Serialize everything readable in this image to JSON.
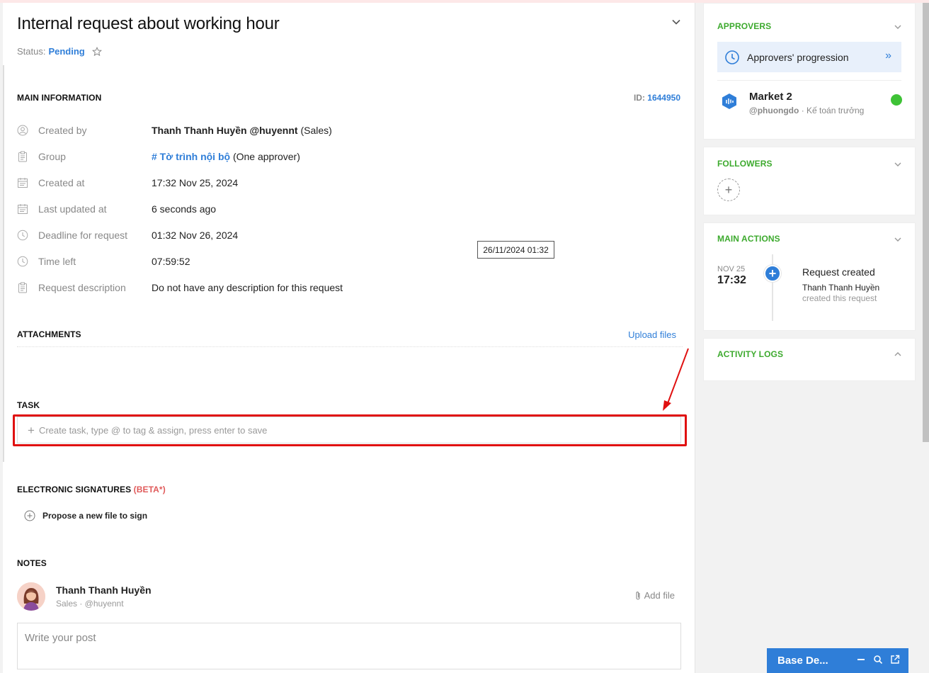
{
  "header": {
    "title": "Internal request about working hour",
    "status_label": "Status:",
    "status_value": "Pending"
  },
  "main_info": {
    "section_title": "MAIN INFORMATION",
    "id_label": "ID:",
    "id_value": "1644950",
    "rows": [
      {
        "label": "Created by",
        "value_name": "Thanh Thanh Huyền @huyennt",
        "value_extra": "(Sales)"
      },
      {
        "label": "Group",
        "value_link": "# Tờ trình nội bộ",
        "value_extra": "(One approver)"
      },
      {
        "label": "Created at",
        "value": "17:32 Nov 25, 2024"
      },
      {
        "label": "Last updated at",
        "value": "6 seconds ago"
      },
      {
        "label": "Deadline for request",
        "value": "01:32 Nov 26, 2024"
      },
      {
        "label": "Time left",
        "value": "07:59:52"
      },
      {
        "label": "Request description",
        "value": "Do not have any description for this request"
      }
    ],
    "tooltip": "26/11/2024 01:32"
  },
  "attachments": {
    "title": "ATTACHMENTS",
    "upload_label": "Upload files"
  },
  "task": {
    "title": "TASK",
    "placeholder": "Create task, type @ to tag & assign, press enter to save"
  },
  "signatures": {
    "title": "ELECTRONIC SIGNATURES",
    "beta": "(BETA*)",
    "propose_label": "Propose a new file to sign"
  },
  "notes": {
    "title": "NOTES",
    "author_name": "Thanh Thanh Huyền",
    "author_sub": "Sales · @huyennt",
    "add_file_label": "Add file",
    "post_placeholder": "Write your post"
  },
  "approvers": {
    "title": "APPROVERS",
    "progression_label": "Approvers' progression",
    "approver_name": "Market 2",
    "approver_handle": "@phuongdo",
    "approver_role": "· Kế toán trưởng",
    "status_color": "#3ec236"
  },
  "followers": {
    "title": "FOLLOWERS"
  },
  "main_actions": {
    "title": "MAIN ACTIONS",
    "date": "NOV 25",
    "time": "17:32",
    "action_title": "Request created",
    "action_user": "Thanh Thanh Huyền",
    "action_desc": "created this request"
  },
  "activity_logs": {
    "title": "ACTIVITY LOGS"
  },
  "bottom_widget": {
    "label": "Base De..."
  },
  "colors": {
    "accent": "#2f7ed8",
    "green": "#3daa2e",
    "highlight": "#e01010"
  }
}
